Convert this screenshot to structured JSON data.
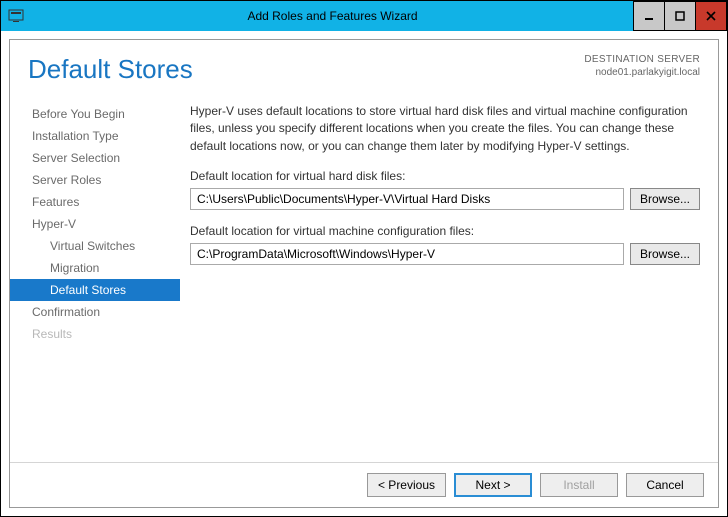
{
  "window": {
    "title": "Add Roles and Features Wizard"
  },
  "header": {
    "page_title": "Default Stores",
    "destination_label": "DESTINATION SERVER",
    "destination_value": "node01.parlakyigit.local"
  },
  "sidebar": {
    "items": [
      {
        "label": "Before You Begin",
        "sub": false,
        "selected": false,
        "disabled": false
      },
      {
        "label": "Installation Type",
        "sub": false,
        "selected": false,
        "disabled": false
      },
      {
        "label": "Server Selection",
        "sub": false,
        "selected": false,
        "disabled": false
      },
      {
        "label": "Server Roles",
        "sub": false,
        "selected": false,
        "disabled": false
      },
      {
        "label": "Features",
        "sub": false,
        "selected": false,
        "disabled": false
      },
      {
        "label": "Hyper-V",
        "sub": false,
        "selected": false,
        "disabled": false
      },
      {
        "label": "Virtual Switches",
        "sub": true,
        "selected": false,
        "disabled": false
      },
      {
        "label": "Migration",
        "sub": true,
        "selected": false,
        "disabled": false
      },
      {
        "label": "Default Stores",
        "sub": true,
        "selected": true,
        "disabled": false
      },
      {
        "label": "Confirmation",
        "sub": false,
        "selected": false,
        "disabled": false
      },
      {
        "label": "Results",
        "sub": false,
        "selected": false,
        "disabled": true
      }
    ]
  },
  "main": {
    "description": "Hyper-V uses default locations to store virtual hard disk files and virtual machine configuration files, unless you specify different locations when you create the files. You can change these default locations now, or you can change them later by modifying Hyper-V settings.",
    "vhd_label": "Default location for virtual hard disk files:",
    "vhd_value": "C:\\Users\\Public\\Documents\\Hyper-V\\Virtual Hard Disks",
    "config_label": "Default location for virtual machine configuration files:",
    "config_value": "C:\\ProgramData\\Microsoft\\Windows\\Hyper-V",
    "browse_label": "Browse..."
  },
  "footer": {
    "previous": "< Previous",
    "next": "Next >",
    "install": "Install",
    "cancel": "Cancel"
  }
}
